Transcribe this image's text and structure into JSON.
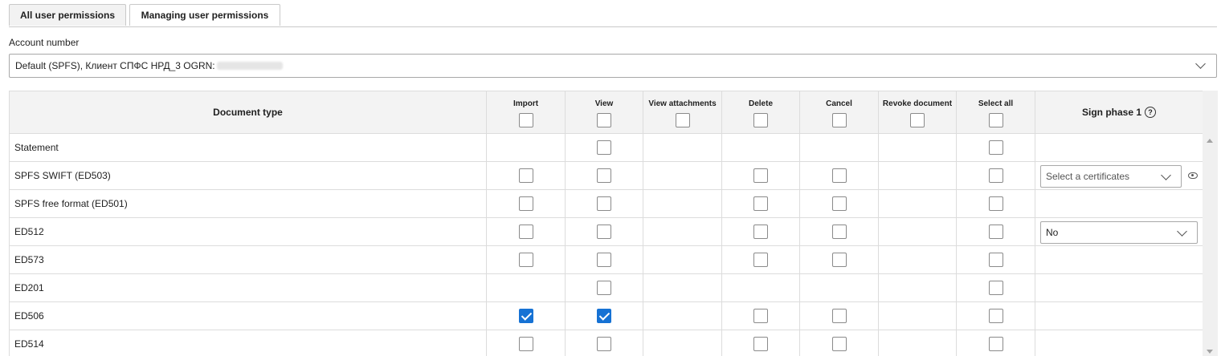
{
  "tabs": [
    {
      "label": "All user permissions",
      "active": false
    },
    {
      "label": "Managing user permissions",
      "active": true
    }
  ],
  "account": {
    "label": "Account number",
    "value": "Default (SPFS), Клиент СПФС НРД_3 OGRN:"
  },
  "table": {
    "headers": {
      "document_type": "Document type",
      "import": "Import",
      "view": "View",
      "view_attachments": "View attachments",
      "delete": "Delete",
      "cancel": "Cancel",
      "revoke_document": "Revoke document",
      "select_all": "Select all",
      "sign_phase_1": "Sign phase 1"
    },
    "rows": [
      {
        "name": "Statement",
        "import": null,
        "view": false,
        "view_attachments": null,
        "delete": null,
        "cancel": null,
        "revoke": null,
        "select_all": false,
        "sign": null
      },
      {
        "name": "SPFS SWIFT (ED503)",
        "import": false,
        "view": false,
        "view_attachments": null,
        "delete": false,
        "cancel": false,
        "revoke": null,
        "select_all": false,
        "sign": "Select a certificates"
      },
      {
        "name": "SPFS free format (ED501)",
        "import": false,
        "view": false,
        "view_attachments": null,
        "delete": false,
        "cancel": false,
        "revoke": null,
        "select_all": false,
        "sign": null
      },
      {
        "name": "ED512",
        "import": false,
        "view": false,
        "view_attachments": null,
        "delete": false,
        "cancel": false,
        "revoke": null,
        "select_all": false,
        "sign": "No"
      },
      {
        "name": "ED573",
        "import": false,
        "view": false,
        "view_attachments": null,
        "delete": false,
        "cancel": false,
        "revoke": null,
        "select_all": false,
        "sign": null
      },
      {
        "name": "ED201",
        "import": null,
        "view": false,
        "view_attachments": null,
        "delete": null,
        "cancel": null,
        "revoke": null,
        "select_all": false,
        "sign": null
      },
      {
        "name": "ED506",
        "import": true,
        "view": true,
        "view_attachments": null,
        "delete": false,
        "cancel": false,
        "revoke": null,
        "select_all": false,
        "sign": null
      },
      {
        "name": "ED514",
        "import": false,
        "view": false,
        "view_attachments": null,
        "delete": false,
        "cancel": false,
        "revoke": null,
        "select_all": false,
        "sign": null
      }
    ]
  },
  "icons": {
    "help": "help-circle-icon",
    "eye": "eye-icon",
    "chevron": "chevron-down-icon"
  },
  "colors": {
    "checkbox_checked": "#1672d4",
    "header_bg": "#f3f3f3",
    "border": "#dcdcdc"
  }
}
